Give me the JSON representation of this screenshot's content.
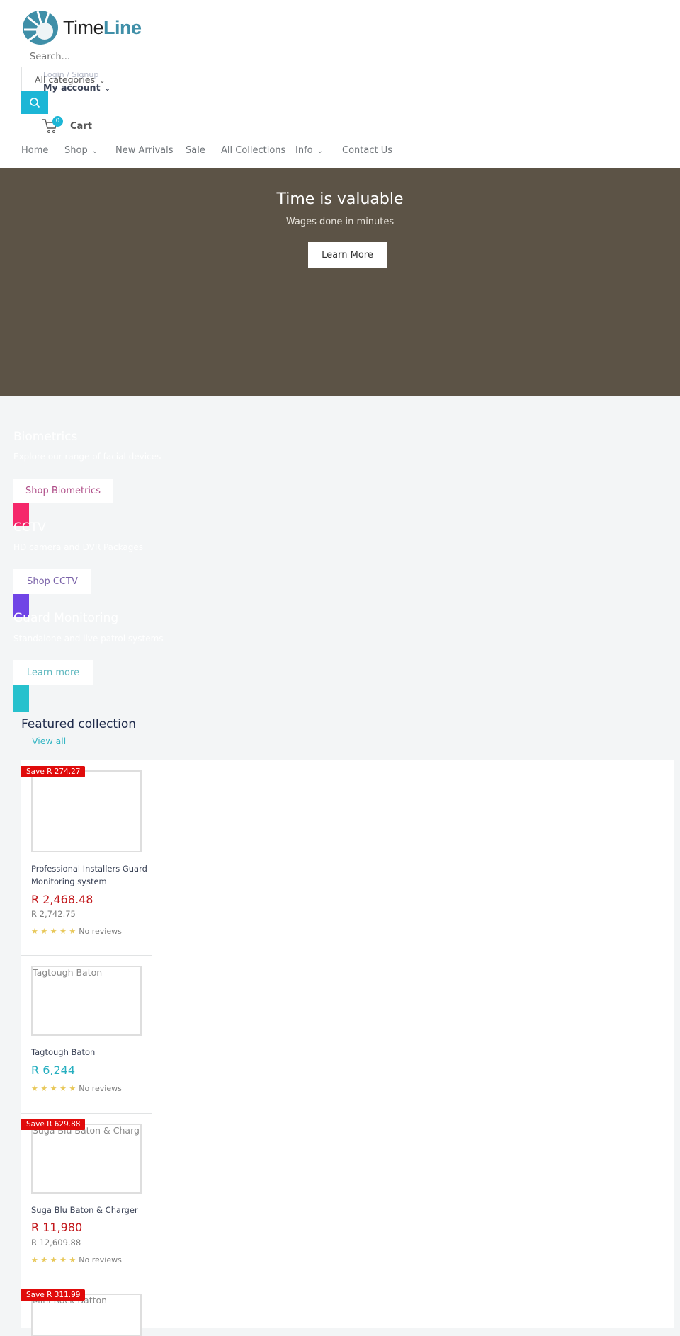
{
  "header": {
    "logo_text_a": "Time",
    "logo_text_b": "Line",
    "search_placeholder": "Search...",
    "login_label": "Login / Signup",
    "categories_label": "All categories",
    "account_label": "My account",
    "cart_label": "Cart",
    "cart_count": "0",
    "accent": "#1cb6d6"
  },
  "nav": [
    {
      "label": "Home"
    },
    {
      "label": "Shop",
      "dropdown": true
    },
    {
      "label": "New Arrivals"
    },
    {
      "label": "Sale"
    },
    {
      "label": "All Collections"
    },
    {
      "label": "Info",
      "dropdown": true
    },
    {
      "label": "Contact Us"
    }
  ],
  "hero": {
    "title": "Time is valuable",
    "subtitle": "Wages done in minutes",
    "button": "Learn More",
    "bg": "#5c5346"
  },
  "promos": [
    {
      "title": "Biometrics",
      "desc": "Explore our range of facial devices",
      "button": "Shop Biometrics",
      "color": "#f5286b",
      "text_color": "#b0508a"
    },
    {
      "title": "CCTV",
      "desc": "HD camera and DVR Packages",
      "button": "Shop CCTV",
      "color": "#7045e6",
      "text_color": "#7a62a8"
    },
    {
      "title": "Guard Monitoring",
      "desc": "Standalone and live patrol systems",
      "button": "Learn more",
      "color": "#27c1cd",
      "text_color": "#5fb8bf"
    }
  ],
  "featured": {
    "title": "Featured collection",
    "view_all": "View all",
    "products": [
      {
        "badge": "Save R 274.27",
        "image_alt": "",
        "title_1": "Professional Installers Guard",
        "title_2": "Monitoring system",
        "price": "R 2,468.48",
        "compare": "R 2,742.75",
        "reviews": "No reviews",
        "rating": 0
      },
      {
        "badge": "",
        "image_alt": "Tagtough Baton",
        "title_1": "Tagtough Baton",
        "title_2": "",
        "price": "R 6,244",
        "compare": "",
        "reviews": "No reviews",
        "rating": 0
      },
      {
        "badge": "Save R 629.88",
        "image_alt": "Suga Blu Baton & Charger",
        "title_1": "Suga Blu Baton & Charger",
        "title_2": "",
        "price": "R 11,980",
        "compare": "R 12,609.88",
        "reviews": "No reviews",
        "rating": 0
      },
      {
        "badge": "Save R 311.99",
        "image_alt": "Mini Rock Batton"
      }
    ]
  }
}
